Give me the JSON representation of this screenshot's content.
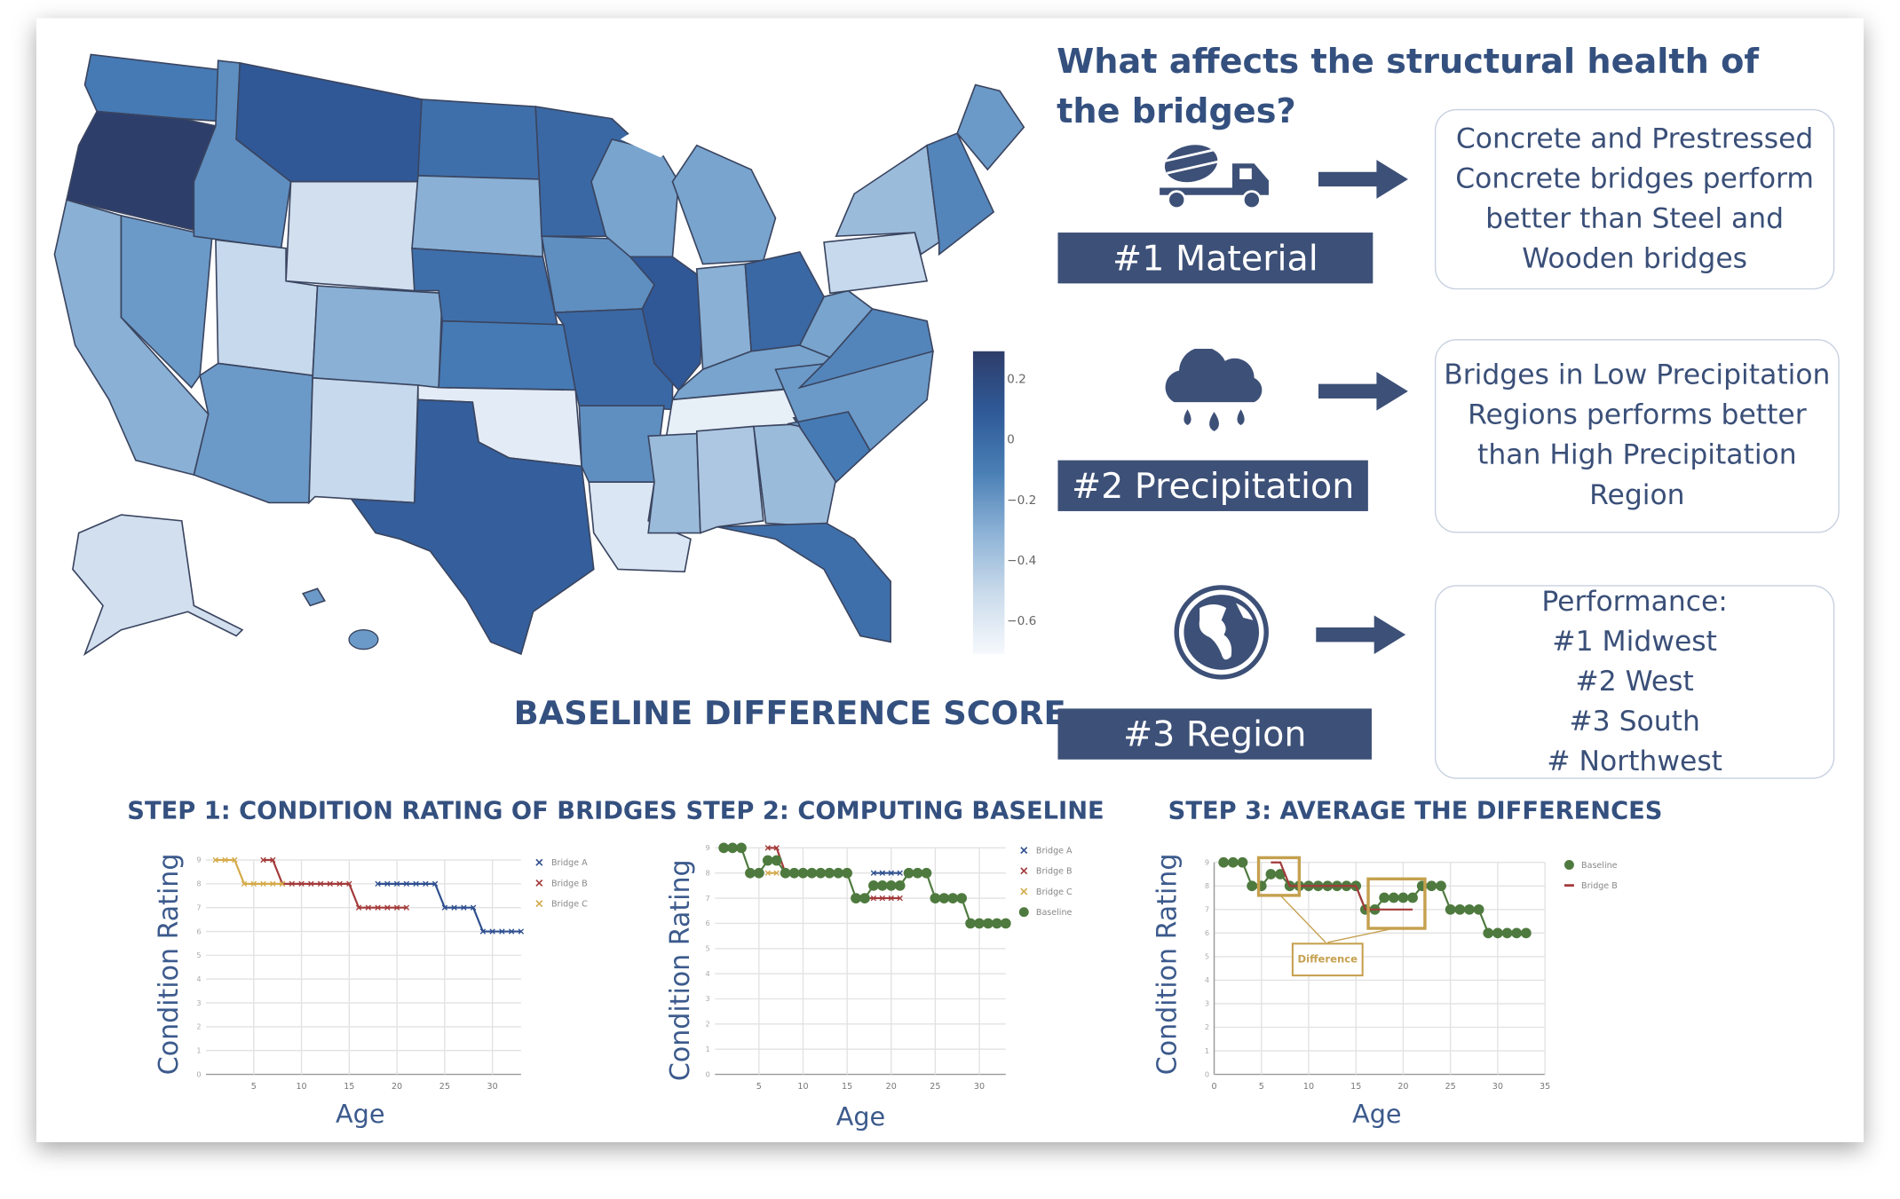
{
  "header": {
    "title": "What affects the structural health of the bridges?"
  },
  "colors": {
    "accent": "#34507f",
    "label_bg": "#3d5077",
    "bridge_a": "#2f4f8f",
    "bridge_b": "#a33a3a",
    "bridge_c": "#d4aa4a",
    "baseline": "#4f7a3f",
    "difference": "#c5a04e"
  },
  "factors": [
    {
      "icon": "cement-truck-icon",
      "label": "#1 Material",
      "description": [
        "Concrete and Prestressed",
        "Concrete bridges perform",
        "better than Steel and",
        "Wooden bridges"
      ]
    },
    {
      "icon": "rain-cloud-icon",
      "label": "#2 Precipitation",
      "description": [
        "Bridges in Low Precipitation",
        "Regions performs better",
        "than High Precipitation",
        "Region"
      ]
    },
    {
      "icon": "globe-icon",
      "label": "#3  Region",
      "description": [
        "Performance:",
        "#1 Midwest",
        "#2 West",
        "#3 South",
        "# Northwest"
      ]
    }
  ],
  "map": {
    "title": "BASELINE DIFFERENCE SCORE",
    "colorbar": {
      "ticks": [
        "0.2",
        "0",
        "−0.2",
        "−0.4",
        "−0.6"
      ],
      "tick_values": [
        0.2,
        0,
        -0.2,
        -0.4,
        -0.6
      ],
      "range": [
        -0.7,
        0.3
      ]
    },
    "states": {
      "WA": 0.0,
      "OR": 0.28,
      "CA": -0.25,
      "NV": -0.15,
      "ID": -0.1,
      "MT": 0.15,
      "WY": -0.5,
      "UT": -0.45,
      "AZ": -0.15,
      "CO": -0.25,
      "NM": -0.45,
      "ND": 0.05,
      "SD": -0.25,
      "NE": 0.05,
      "KS": 0.0,
      "OK": -0.6,
      "TX": 0.12,
      "MN": 0.08,
      "IA": -0.1,
      "MO": 0.08,
      "AR": -0.1,
      "LA": -0.55,
      "WI": -0.2,
      "IL": 0.15,
      "MI": -0.2,
      "IN": -0.25,
      "OH": 0.08,
      "KY": -0.2,
      "TN": -0.62,
      "MS": -0.3,
      "AL": -0.35,
      "GA": -0.3,
      "FL": 0.05,
      "SC": 0.0,
      "NC": -0.15,
      "VA": -0.05,
      "WV": -0.2,
      "PA": -0.45,
      "NY": -0.3,
      "NE_REGION": -0.05,
      "ME": -0.15,
      "AK": -0.5,
      "HI": -0.15
    }
  },
  "steps": [
    {
      "title": "STEP 1: CONDITION RATING OF BRIDGES"
    },
    {
      "title": "STEP 2: COMPUTING BASELINE"
    },
    {
      "title": "STEP 3: AVERAGE THE DIFFERENCES"
    }
  ],
  "chart_data": [
    {
      "type": "line",
      "xlabel": "Age",
      "ylabel": "Condition Rating",
      "xlim": [
        0,
        33
      ],
      "ylim": [
        0,
        9
      ],
      "xticks": [
        5,
        10,
        15,
        20,
        25,
        30
      ],
      "yticks": [
        0,
        1,
        2,
        3,
        4,
        5,
        6,
        7,
        8,
        9
      ],
      "grid": true,
      "legend": "right",
      "series": [
        {
          "name": "Bridge A",
          "marker": "x",
          "color": "#2f4f8f",
          "x": [
            18,
            19,
            20,
            21,
            22,
            23,
            24,
            25,
            26,
            27,
            28,
            29,
            30,
            31,
            32,
            33
          ],
          "y": [
            8,
            8,
            8,
            8,
            8,
            8,
            8,
            7,
            7,
            7,
            7,
            6,
            6,
            6,
            6,
            6
          ]
        },
        {
          "name": "Bridge B",
          "marker": "x",
          "color": "#a33a3a",
          "x": [
            6,
            7,
            8,
            9,
            10,
            11,
            12,
            13,
            14,
            15,
            16,
            17,
            18,
            19,
            20,
            21
          ],
          "y": [
            9,
            9,
            8,
            8,
            8,
            8,
            8,
            8,
            8,
            8,
            7,
            7,
            7,
            7,
            7,
            7
          ]
        },
        {
          "name": "Bridge C",
          "marker": "x",
          "color": "#d4aa4a",
          "x": [
            1,
            2,
            3,
            4,
            5,
            6,
            7,
            8
          ],
          "y": [
            9,
            9,
            9,
            8,
            8,
            8,
            8,
            8
          ]
        }
      ]
    },
    {
      "type": "line",
      "xlabel": "Age",
      "ylabel": "Condition Rating",
      "xlim": [
        0,
        33
      ],
      "ylim": [
        0,
        9
      ],
      "xticks": [
        5,
        10,
        15,
        20,
        25,
        30
      ],
      "yticks": [
        0,
        1,
        2,
        3,
        4,
        5,
        6,
        7,
        8,
        9
      ],
      "grid": true,
      "legend": "right",
      "series": [
        {
          "name": "Bridge A",
          "marker": "x",
          "color": "#2f4f8f",
          "x": [
            18,
            19,
            20,
            21
          ],
          "y": [
            8,
            8,
            8,
            8
          ]
        },
        {
          "name": "Bridge B",
          "marker": "x",
          "color": "#a33a3a",
          "x": [
            6,
            7,
            8,
            16,
            17,
            18,
            19,
            20,
            21
          ],
          "y": [
            9,
            9,
            8,
            7,
            7,
            7,
            7,
            7,
            7
          ]
        },
        {
          "name": "Bridge C",
          "marker": "x",
          "color": "#d4aa4a",
          "x": [
            6,
            7
          ],
          "y": [
            8,
            8
          ]
        },
        {
          "name": "Baseline",
          "marker": "dot",
          "color": "#4f7a3f",
          "x": [
            1,
            2,
            3,
            4,
            5,
            6,
            7,
            8,
            9,
            10,
            11,
            12,
            13,
            14,
            15,
            16,
            17,
            18,
            19,
            20,
            21,
            22,
            23,
            24,
            25,
            26,
            27,
            28,
            29,
            30,
            31,
            32,
            33
          ],
          "y": [
            9,
            9,
            9,
            8,
            8,
            8.5,
            8.5,
            8,
            8,
            8,
            8,
            8,
            8,
            8,
            8,
            7,
            7,
            7.5,
            7.5,
            7.5,
            7.5,
            8,
            8,
            8,
            7,
            7,
            7,
            7,
            6,
            6,
            6,
            6,
            6
          ]
        }
      ]
    },
    {
      "type": "line",
      "xlabel": "Age",
      "ylabel": "Condition Rating",
      "xlim": [
        0,
        35
      ],
      "ylim": [
        0,
        9
      ],
      "xticks": [
        0,
        5,
        10,
        15,
        20,
        25,
        30,
        35
      ],
      "yticks": [
        0,
        1,
        2,
        3,
        4,
        5,
        6,
        7,
        8,
        9
      ],
      "grid": true,
      "legend": "right",
      "annotation": "Difference",
      "series": [
        {
          "name": "Baseline",
          "marker": "dot",
          "color": "#4f7a3f",
          "x": [
            1,
            2,
            3,
            4,
            5,
            6,
            7,
            8,
            9,
            10,
            11,
            12,
            13,
            14,
            15,
            16,
            17,
            18,
            19,
            20,
            21,
            22,
            23,
            24,
            25,
            26,
            27,
            28,
            29,
            30,
            31,
            32,
            33
          ],
          "y": [
            9,
            9,
            9,
            8,
            8,
            8.5,
            8.5,
            8,
            8,
            8,
            8,
            8,
            8,
            8,
            8,
            7,
            7,
            7.5,
            7.5,
            7.5,
            7.5,
            8,
            8,
            8,
            7,
            7,
            7,
            7,
            6,
            6,
            6,
            6,
            6
          ]
        },
        {
          "name": "Bridge B",
          "marker": "line",
          "color": "#a33a3a",
          "x": [
            6,
            7,
            8,
            9,
            10,
            11,
            12,
            13,
            14,
            15,
            16,
            17,
            18,
            19,
            20,
            21
          ],
          "y": [
            9,
            9,
            8,
            8,
            8,
            8,
            8,
            8,
            8,
            8,
            7,
            7,
            7,
            7,
            7,
            7
          ]
        }
      ]
    }
  ]
}
